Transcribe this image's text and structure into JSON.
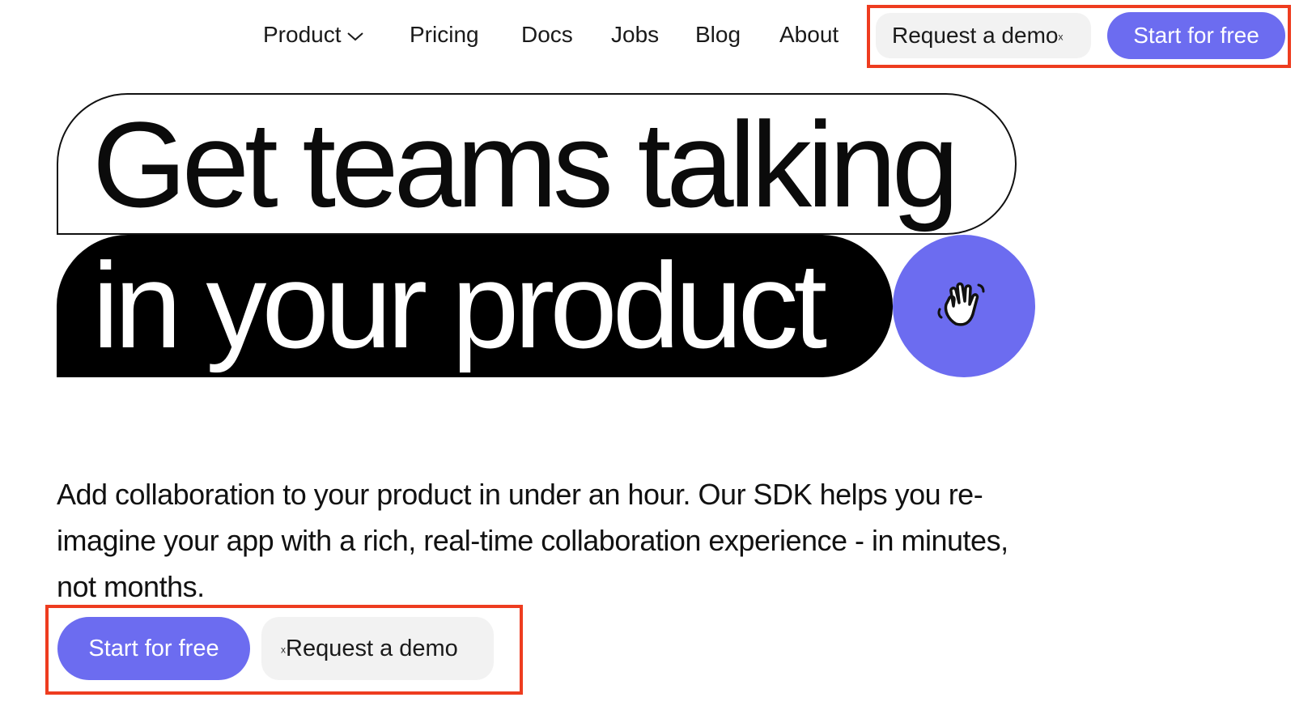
{
  "nav": {
    "items": [
      {
        "label": "Product",
        "has_dropdown": true
      },
      {
        "label": "Pricing"
      },
      {
        "label": "Docs"
      },
      {
        "label": "Jobs"
      },
      {
        "label": "Blog"
      },
      {
        "label": "About"
      }
    ],
    "demo_button": {
      "label": "Request a demo",
      "mark": "x"
    },
    "start_button": {
      "label": "Start for free"
    }
  },
  "hero": {
    "line1": "Get teams talking",
    "line2": "in your product",
    "badge_icon": "waving-hand-icon"
  },
  "description": "Add collaboration to your product in under an hour. Our SDK helps you re-imagine your app with a rich, real-time collaboration experience - in minutes, not months.",
  "cta": {
    "start_button": {
      "label": "Start for free"
    },
    "demo_button": {
      "label": "Request a demo",
      "mark": "x"
    }
  },
  "colors": {
    "accent": "#6c6cf0",
    "highlight": "#ee3c1f",
    "secondary_button_bg": "#f2f2f2",
    "text": "#111111"
  }
}
